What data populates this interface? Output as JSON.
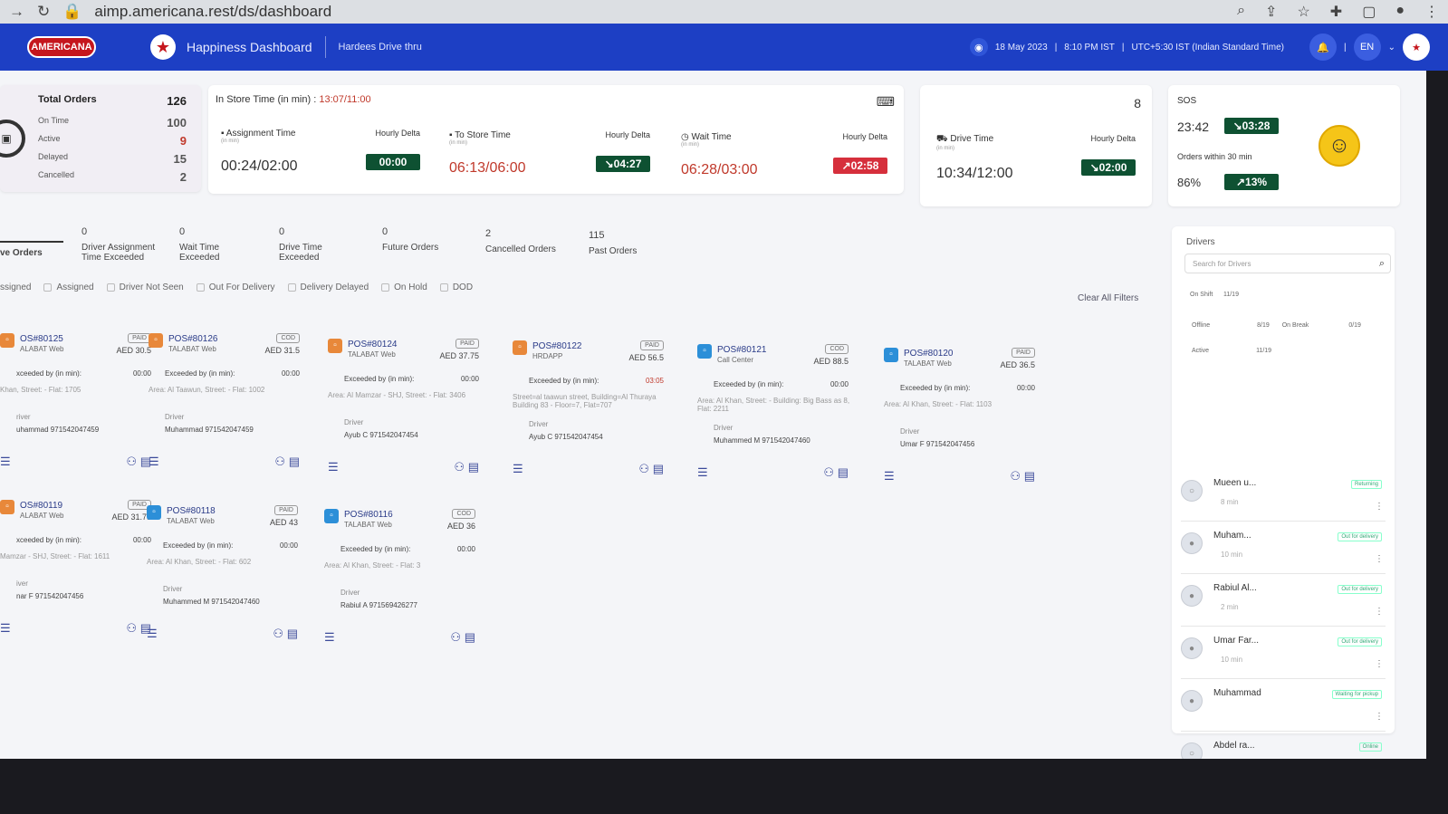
{
  "browser": {
    "url": "aimp.americana.rest/ds/dashboard"
  },
  "nav": {
    "logo": "AMERICANA",
    "title": "Happiness Dashboard",
    "brand": "Hardees Drive thru",
    "date": "18 May 2023",
    "time": "8:10 PM IST",
    "tz": "UTC+5:30 IST (Indian Standard Time)",
    "lang": "EN"
  },
  "totals": {
    "title": "Total Orders",
    "total": "126",
    "rows": [
      {
        "label": "On Time",
        "value": "100"
      },
      {
        "label": "Active",
        "value": "9"
      },
      {
        "label": "Delayed",
        "value": "15"
      },
      {
        "label": "Cancelled",
        "value": "2"
      }
    ]
  },
  "instore": {
    "title": "In Store Time (in min) :",
    "value": "13:07/11:00"
  },
  "metrics": [
    {
      "label": "Assignment Time",
      "sub": "(in min)",
      "delta_label": "Hourly Delta",
      "value": "00:24/02:00",
      "delta": "00:00"
    },
    {
      "label": "To Store Time",
      "sub": "(in min)",
      "delta_label": "Hourly Delta",
      "value": "06:13/06:00",
      "delta": "04:27"
    },
    {
      "label": "Wait Time",
      "sub": "(in min)",
      "delta_label": "Hourly Delta",
      "value": "06:28/03:00",
      "delta": "02:58"
    },
    {
      "label": "Drive Time",
      "sub": "(in min)",
      "delta_label": "Hourly Delta",
      "value": "10:34/12:00",
      "delta": "02:00"
    }
  ],
  "drive_count": "8",
  "sos": {
    "title": "SOS",
    "value": "23:42",
    "delta": "03:28",
    "sub": "Orders within 30 min",
    "pct": "86%",
    "pct_delta": "13%"
  },
  "tabs": [
    {
      "n": "",
      "label": "ve Orders"
    },
    {
      "n": "0",
      "label": "Driver Assignment Time Exceeded"
    },
    {
      "n": "0",
      "label": "Wait Time Exceeded"
    },
    {
      "n": "0",
      "label": "Drive Time Exceeded"
    },
    {
      "n": "0",
      "label": "Future Orders"
    },
    {
      "n": "2",
      "label": "Cancelled Orders"
    },
    {
      "n": "115",
      "label": "Past Orders"
    }
  ],
  "filters": [
    "ssigned",
    "Assigned",
    "Driver Not Seen",
    "Out For Delivery",
    "Delivery Delayed",
    "On Hold",
    "DOD"
  ],
  "clear_filters": "Clear All Filters",
  "orders": [
    {
      "pos": "OS#80125",
      "src": "ALABAT Web",
      "pay": "PAID",
      "amt": "AED 30.5",
      "exc": "xceeded by (in min):",
      "excv": "00:00",
      "addr": "Khan, Street: - Flat: 1705",
      "drv": "river",
      "dn": "uhammad 971542047459"
    },
    {
      "pos": "POS#80126",
      "src": "TALABAT Web",
      "pay": "COD",
      "amt": "AED 31.5",
      "exc": "Exceeded by (in min):",
      "excv": "00:00",
      "addr": "Area: Al Taawun, Street: - Flat: 1002",
      "drv": "Driver",
      "dn": "Muhammad 971542047459"
    },
    {
      "pos": "POS#80124",
      "src": "TALABAT Web",
      "pay": "PAID",
      "amt": "AED 37.75",
      "exc": "Exceeded by (in min):",
      "excv": "00:00",
      "addr": "Area: Al Mamzar - SHJ, Street: - Flat: 3406",
      "drv": "Driver",
      "dn": "Ayub C 971542047454"
    },
    {
      "pos": "POS#80122",
      "src": "HRDAPP",
      "pay": "PAID",
      "amt": "AED 56.5",
      "exc": "Exceeded by (in min):",
      "excv": "03:05",
      "addr": "Street=al taawun street, Building=Al Thuraya Building 83 - Floor=7, Flat=707",
      "drv": "Driver",
      "dn": "Ayub C 971542047454"
    },
    {
      "pos": "POS#80121",
      "src": "Call Center",
      "pay": "COD",
      "amt": "AED 88.5",
      "exc": "Exceeded by (in min):",
      "excv": "00:00",
      "addr": "Area: Al Khan, Street: - Building: Big Bass as 8, Flat: 2211",
      "drv": "Driver",
      "dn": "Muhammed M 971542047460"
    },
    {
      "pos": "POS#80120",
      "src": "TALABAT Web",
      "pay": "PAID",
      "amt": "AED 36.5",
      "exc": "Exceeded by (in min):",
      "excv": "00:00",
      "addr": "Area: Al Khan, Street: - Flat: 1103",
      "drv": "Driver",
      "dn": "Umar F 971542047456"
    },
    {
      "pos": "OS#80119",
      "src": "ALABAT Web",
      "pay": "PAID",
      "amt": "AED 31.75",
      "exc": "xceeded by (in min):",
      "excv": "00:00",
      "addr": "Mamzar - SHJ, Street: - Flat: 1611",
      "drv": "iver",
      "dn": "nar F 971542047456"
    },
    {
      "pos": "POS#80118",
      "src": "TALABAT Web",
      "pay": "PAID",
      "amt": "AED 43",
      "exc": "Exceeded by (in min):",
      "excv": "00:00",
      "addr": "Area: Al Khan, Street: - Flat: 602",
      "drv": "Driver",
      "dn": "Muhammed M 971542047460"
    },
    {
      "pos": "POS#80116",
      "src": "TALABAT Web",
      "pay": "COD",
      "amt": "AED 36",
      "exc": "Exceeded by (in min):",
      "excv": "00:00",
      "addr": "Area: Al Khan, Street: - Flat: 3",
      "drv": "Driver",
      "dn": "Rabiul A 971569426277"
    }
  ],
  "drivers": {
    "title": "Drivers",
    "search_placeholder": "Search for Drivers",
    "on_shift": "On Shift",
    "on_shift_v": "11/19",
    "offline": "Offline",
    "offline_v": "8/19",
    "on_break": "On Break",
    "on_break_v": "0/19",
    "active": "Active",
    "active_v": "11/19",
    "list": [
      {
        "name": "Mueen u...",
        "time": "8 min",
        "status": "Returning"
      },
      {
        "name": "Muham...",
        "time": "10 min",
        "status": "Out for delivery"
      },
      {
        "name": "Rabiul Al...",
        "time": "2 min",
        "status": "Out for delivery"
      },
      {
        "name": "Umar Far...",
        "time": "10 min",
        "status": "Out for delivery"
      },
      {
        "name": "Muhammad",
        "time": "",
        "status": "Waiting for pickup"
      },
      {
        "name": "Abdel ra...",
        "time": "",
        "status": "Online"
      }
    ]
  }
}
